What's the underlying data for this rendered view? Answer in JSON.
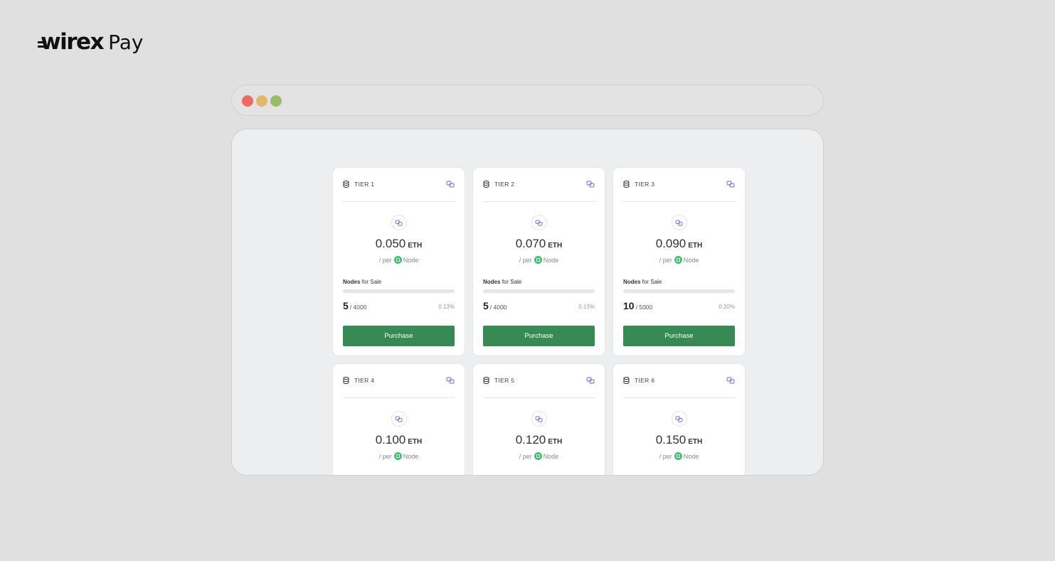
{
  "brand": {
    "logo_text": "wirex",
    "product": "Pay"
  },
  "colors": {
    "background": "#e0e0e0",
    "window": "#edeef0",
    "card": "#ffffff",
    "button": "#378a54",
    "accent_icon": "#8a7fd8",
    "node_badge": "#3ec26c",
    "dot_red": "#ec6b64",
    "dot_yellow": "#e2b86a",
    "dot_green": "#98bd68"
  },
  "labels": {
    "unit": "ETH",
    "per_prefix": "/ per",
    "node": "Node",
    "nodes_word": "Nodes",
    "for_sale": "for Sale",
    "purchase": "Purchase"
  },
  "icons": {
    "tier": "database-icon",
    "chain": "polygon-link-icon",
    "node": "node-cube-icon"
  },
  "tiers": [
    {
      "label": "TIER 1",
      "price": "0.050",
      "sold": "5",
      "total": "/ 4000",
      "percent": "0.13%",
      "progress": 0.13
    },
    {
      "label": "TIER 2",
      "price": "0.070",
      "sold": "5",
      "total": "/ 4000",
      "percent": "0.13%",
      "progress": 0.13
    },
    {
      "label": "TIER 3",
      "price": "0.090",
      "sold": "10",
      "total": "/ 5000",
      "percent": "0.20%",
      "progress": 0.2
    },
    {
      "label": "TIER 4",
      "price": "0.100"
    },
    {
      "label": "TIER 5",
      "price": "0.120"
    },
    {
      "label": "TIER 6",
      "price": "0.150"
    }
  ]
}
